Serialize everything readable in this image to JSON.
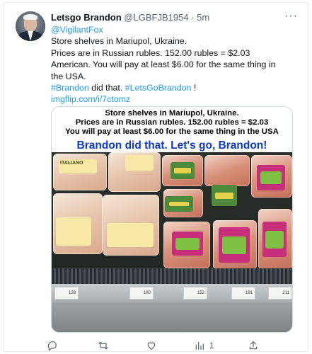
{
  "tweet": {
    "display_name": "Letsgo Brandon",
    "handle": "@LGBFJB1954",
    "separator": "·",
    "time": "5m",
    "more_glyph": "···",
    "reply_to": "@VigilantFox",
    "text_lines": [
      "Store shelves in Mariupol, Ukraine.",
      "Prices are in Russian rubles. 152.00 rubles = $2.03",
      "American. You will pay at least $6.00 for the same thing in",
      "the USA."
    ],
    "hashtag1": "#Brandon",
    "mid_text": " did that. ",
    "hashtag2": "#LetsGoBrandon",
    "end_text": " !",
    "link": "imgflip.com/i/7ctomz"
  },
  "media": {
    "caption_line1": "Store shelves in Mariupol, Ukraine.",
    "caption_line2": "Prices are in Russian rubles. 152.00 rubles = $2.03",
    "caption_line3": "You will pay at least $6.00 for the same thing in the USA",
    "caption_line4": "Brandon did that. Let's go, Brandon!",
    "package_label_left": "ITALIANO",
    "price_tags": [
      "133",
      "180",
      "152",
      "181",
      "211"
    ]
  },
  "actions": {
    "reply_icon": "reply-icon",
    "retweet_icon": "retweet-icon",
    "like_icon": "like-icon",
    "views_icon": "views-icon",
    "views_count": "1",
    "share_icon": "share-icon"
  },
  "colors": {
    "link": "#1d9bf0",
    "caption_blue": "#0a39c9",
    "muted": "#536471"
  }
}
